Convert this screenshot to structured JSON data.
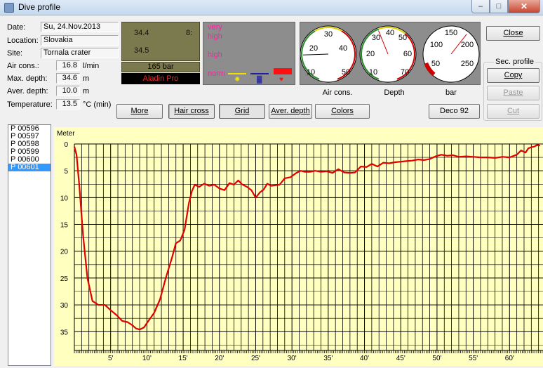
{
  "window": {
    "title": "Dive profile"
  },
  "info": {
    "date_label": "Date:",
    "date": "Su, 24.Nov.2013",
    "location_label": "Location:",
    "location": "Slovakia",
    "site_label": "Site:",
    "site": "Tornala crater",
    "air_label": "Air cons.:",
    "air": "16.8",
    "air_unit": "l/min",
    "maxdepth_label": "Max. depth:",
    "maxdepth": "34.6",
    "maxdepth_unit": "m",
    "avdepth_label": "Aver. depth:",
    "avdepth": "10.0",
    "avdepth_unit": "m",
    "temp_label": "Temperature:",
    "temp": "13.5",
    "temp_unit": "°C  (min)"
  },
  "computer": {
    "val1": "34.4",
    "val2": "8:",
    "val3": "34.5",
    "pressure": "165 bar",
    "model": "Aladin Pro"
  },
  "warnings": {
    "very": "very",
    "high1": "high",
    "high2": "high",
    "norm": "norm"
  },
  "gauges": {
    "air": {
      "label": "Air cons.",
      "ticks": [
        "30",
        "20",
        "40",
        "10",
        "50"
      ],
      "value": 16.8
    },
    "depth": {
      "label": "Depth",
      "ticks": [
        "40",
        "30",
        "50",
        "20",
        "60",
        "10",
        "70"
      ],
      "value": 34.6
    },
    "bar": {
      "label": "bar",
      "ticks": [
        "150",
        "100",
        "200",
        "50",
        "250"
      ],
      "value": 165
    }
  },
  "buttons": {
    "close": "Close",
    "sec_profile": "Sec. profile",
    "copy": "Copy",
    "paste": "Paste",
    "cut": "Cut",
    "more": "More",
    "hair": "Hair cross",
    "grid": "Grid",
    "aver": "Aver. depth",
    "colors": "Colors",
    "deco": "Deco 92"
  },
  "dives": [
    "P 00596",
    "P 00597",
    "P 00598",
    "P 00599",
    "P 00600",
    "P 00601"
  ],
  "selected_dive": 5,
  "chart_data": {
    "type": "line",
    "ylabel": "Meter",
    "xlim": [
      0,
      65
    ],
    "ylim": [
      0,
      38.5
    ],
    "y_inverted": true,
    "x_ticks": [
      5,
      10,
      15,
      20,
      25,
      30,
      35,
      40,
      45,
      50,
      55,
      60
    ],
    "x_tick_labels": [
      "5'",
      "10'",
      "15'",
      "20'",
      "25'",
      "30'",
      "35'",
      "40'",
      "45'",
      "50'",
      "55'",
      "60'"
    ],
    "y_ticks": [
      0,
      5,
      10,
      15,
      20,
      25,
      30,
      35
    ],
    "colors": {
      "background": "#ffffc0",
      "line": "#e00000",
      "grid": "#000000"
    },
    "series": [
      {
        "x": [
          0,
          0.3,
          0.7,
          1.2,
          1.8,
          2.5,
          3.3,
          4.2,
          5.0,
          5.9,
          6.6,
          7.3,
          8.0,
          8.5,
          9.0,
          9.6,
          10.2,
          11.0,
          11.8,
          12.6,
          13.5,
          14.0,
          14.6,
          15.2,
          15.8,
          16.2,
          16.6,
          17.2,
          17.9,
          18.6,
          19.3,
          20.0,
          20.7,
          21.4,
          22.0,
          22.6,
          23.1,
          23.8,
          24.4,
          25.0,
          25.6,
          26.1,
          26.6,
          27.1,
          27.7,
          28.3,
          29.0,
          29.8,
          30.6,
          31.2,
          31.8,
          32.5,
          33.2,
          34.0,
          34.8,
          35.6,
          36.4,
          37.2,
          38.0,
          38.7,
          39.5,
          40.3,
          41.0,
          41.8,
          42.6,
          43.4,
          44.2,
          45.0,
          45.8,
          46.6,
          47.4,
          48.2,
          49.0,
          49.8,
          50.6,
          51.4,
          52.2,
          53.0,
          54.0,
          55.0,
          56.0,
          57.0,
          58.0,
          59.0,
          60.0,
          61.0,
          61.6,
          62.2,
          62.6,
          63.0,
          63.4,
          63.8,
          64.2
        ],
        "y": [
          0.5,
          2.0,
          8.0,
          17.0,
          25.0,
          29.3,
          30.0,
          30.0,
          31.0,
          32.0,
          33.0,
          33.2,
          33.8,
          34.4,
          34.6,
          34.2,
          33.0,
          31.5,
          29.0,
          25.0,
          21.0,
          18.5,
          18.0,
          16.0,
          11.0,
          8.8,
          7.6,
          8.0,
          7.4,
          7.8,
          7.6,
          8.3,
          8.6,
          7.3,
          7.6,
          6.8,
          7.5,
          8.0,
          8.6,
          10.0,
          9.0,
          8.5,
          7.4,
          7.8,
          7.7,
          7.6,
          6.4,
          6.2,
          5.4,
          5.0,
          5.2,
          5.2,
          5.0,
          5.2,
          5.1,
          5.4,
          4.7,
          5.3,
          5.4,
          5.3,
          4.2,
          4.3,
          3.7,
          4.2,
          3.5,
          3.6,
          3.4,
          3.3,
          3.2,
          3.1,
          2.9,
          3.0,
          2.8,
          2.3,
          2.0,
          2.2,
          2.1,
          2.4,
          2.3,
          2.4,
          2.5,
          2.5,
          2.6,
          2.4,
          2.5,
          2.0,
          1.2,
          1.6,
          0.8,
          0.6,
          0.5,
          0.2,
          0.3
        ]
      }
    ]
  }
}
